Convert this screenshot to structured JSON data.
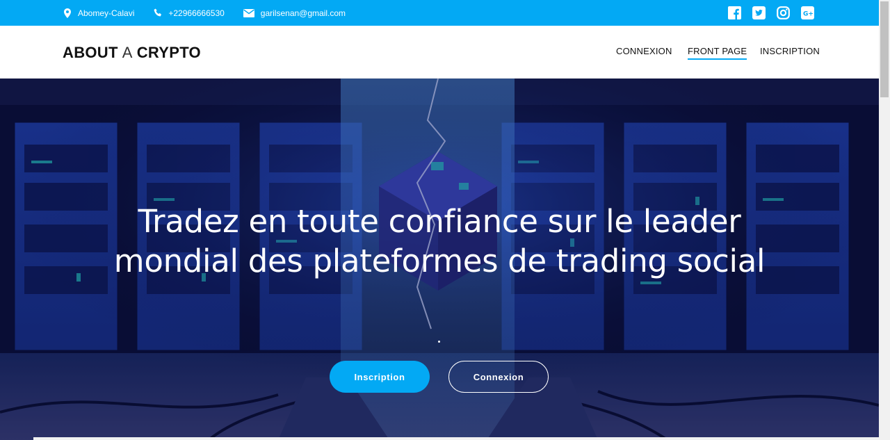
{
  "colors": {
    "accent": "#03a9f4",
    "hero_bg": "#0b0f38"
  },
  "topbar": {
    "contact": [
      {
        "icon": "location-pin-icon",
        "text": "Abomey-Calavi"
      },
      {
        "icon": "phone-icon",
        "text": "+22966666530"
      },
      {
        "icon": "envelope-icon",
        "text": "garilsenan@gmail.com"
      }
    ],
    "social": [
      "facebook-icon",
      "twitter-icon",
      "instagram-icon",
      "google-plus-icon"
    ]
  },
  "header": {
    "brand_part1": "ABOUT",
    "brand_part2": "A",
    "brand_part3": "CRYPTO",
    "nav": [
      {
        "label": "CONNEXION",
        "active": false
      },
      {
        "label": "FRONT PAGE",
        "active": true
      },
      {
        "label": "INSCRIPTION",
        "active": false
      }
    ]
  },
  "hero": {
    "title": "Tradez en toute confiance sur le leader mondial des plateformes de trading social",
    "dot": ".",
    "primary_button": "Inscription",
    "secondary_button": "Connexion"
  }
}
